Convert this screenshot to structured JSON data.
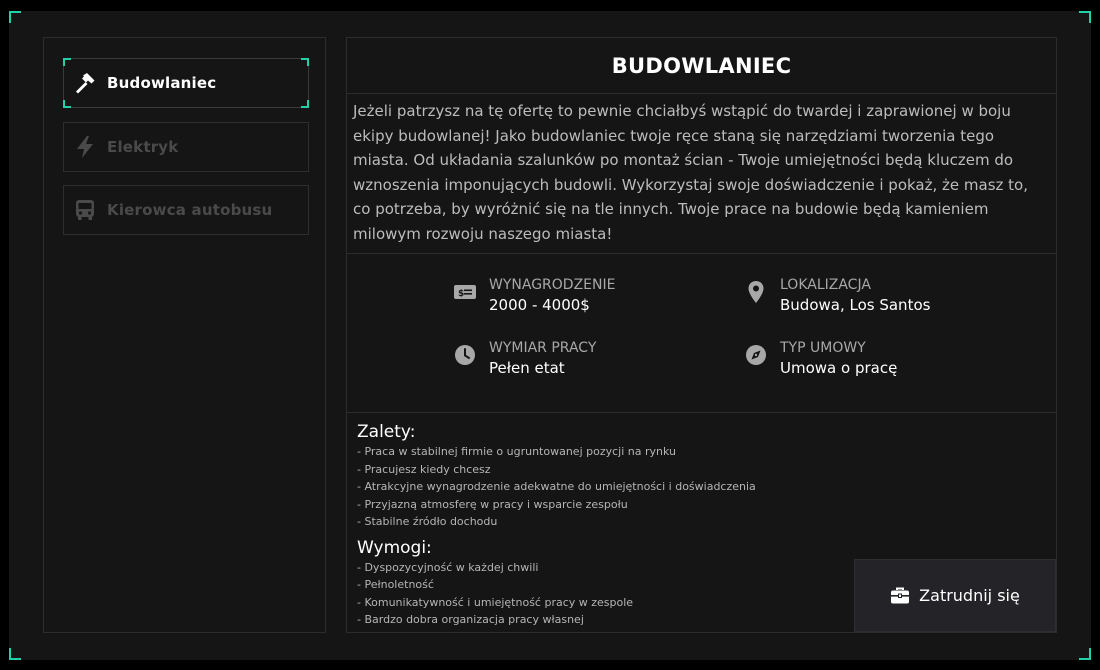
{
  "sidebar": {
    "items": [
      {
        "label": "Budowlaniec",
        "icon": "hammer-icon",
        "active": true
      },
      {
        "label": "Elektryk",
        "icon": "lightning-icon",
        "active": false
      },
      {
        "label": "Kierowca autobusu",
        "icon": "bus-icon",
        "active": false
      }
    ]
  },
  "job": {
    "title": "BUDOWLANIEC",
    "description": "Jeżeli patrzysz na tę ofertę to pewnie chciałbyś wstąpić do twardej i zaprawionej w boju ekipy budowlanej! Jako budowlaniec twoje ręce staną się narzędziami tworzenia tego miasta. Od układania szalunków po montaż ścian - Twoje umiejętności będą kluczem do wznoszenia imponujących budowli. Wykorzystaj swoje doświadczenie i pokaż, że masz to, co potrzeba, by wyróżnić się na tle innych. Twoje prace na budowie będą kamieniem milowym rozwoju naszego miasta!",
    "stats": {
      "salary": {
        "label": "WYNAGRODZENIE",
        "value": "2000 - 4000$",
        "icon": "money-icon"
      },
      "location": {
        "label": "LOKALIZACJA",
        "value": "Budowa, Los Santos",
        "icon": "location-pin-icon"
      },
      "hours": {
        "label": "WYMIAR PRACY",
        "value": "Pełen etat",
        "icon": "clock-icon"
      },
      "contract": {
        "label": "TYP UMOWY",
        "value": "Umowa o pracę",
        "icon": "compass-icon"
      }
    },
    "pros_title": "Zalety:",
    "pros": [
      "- Praca w stabilnej firmie o ugruntowanej pozycji na rynku",
      "- Pracujesz kiedy chcesz",
      "- Atrakcyjne wynagrodzenie adekwatne do umiejętności i doświadczenia",
      "- Przyjazną atmosferę w pracy i wsparcie zespołu",
      "- Stabilne źródło dochodu"
    ],
    "reqs_title": "Wymogi:",
    "reqs": [
      "- Dyspozycyjność w każdej chwili",
      "- Pełnoletność",
      "- Komunikatywność i umiejętność pracy w zespole",
      "- Bardzo dobra organizacja pracy własnej"
    ]
  },
  "hire_button": {
    "label": "Zatrudnij się",
    "icon": "briefcase-icon"
  },
  "colors": {
    "accent": "#1fd1a6",
    "background": "#151515",
    "inactive": "#4a4a4a"
  }
}
